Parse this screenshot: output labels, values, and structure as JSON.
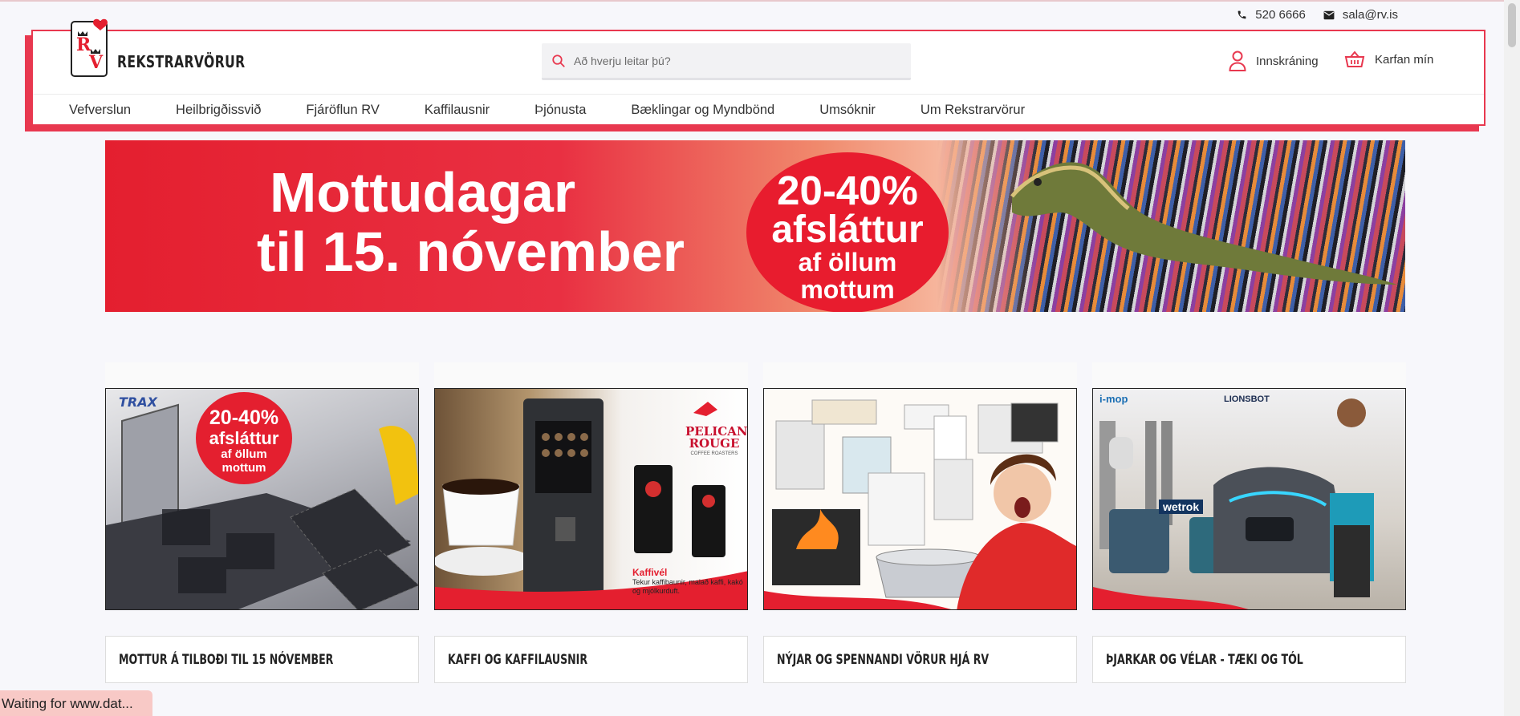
{
  "contact": {
    "phone": "520 6666",
    "email": "sala@rv.is"
  },
  "brand": {
    "name": "REKSTRARVÖRUR"
  },
  "search": {
    "placeholder": "Að hverju leitar þú?"
  },
  "account": {
    "login": "Innskráning",
    "cart": "Karfan mín"
  },
  "nav": [
    "Vefverslun",
    "Heilbrigðissvið",
    "Fjáröflun RV",
    "Kaffilausnir",
    "Þjónusta",
    "Bæklingar og Myndbönd",
    "Umsóknir",
    "Um Rekstrarvörur"
  ],
  "banner": {
    "line1": "Mottudagar",
    "line2": "til 15. nóvember",
    "badge_pct": "20-40%",
    "badge_word": "afsláttur",
    "badge_line3": "af öllum",
    "badge_line4": "mottum"
  },
  "cards": [
    {
      "title": "MOTTUR Á TILBOÐI TIL 15 NÓVEMBER",
      "brand": "TRAX",
      "badge": [
        "20-40%",
        "afsláttur",
        "af öllum",
        "mottum"
      ]
    },
    {
      "title": "KAFFI OG KAFFILAUSNIR",
      "brand": "PELICAN ROUGE",
      "brand_sub": "COFFEE ROASTERS",
      "note_title": "Kaffivél",
      "note_text": "Tekur kaffibaunir, malað kaffi, kakó og mjólkurduft."
    },
    {
      "title": "NÝJAR OG SPENNANDI VÖRUR HJÁ RV"
    },
    {
      "title": "ÞJARKAR OG VÉLAR - TÆKI OG TÓL",
      "brand1": "i-mop",
      "brand2": "LIONSBOT",
      "brand3": "wetrok"
    }
  ],
  "status_bar": "Waiting for www.dat...",
  "colors": {
    "accent": "#e8384f",
    "red": "#e41f2f"
  }
}
